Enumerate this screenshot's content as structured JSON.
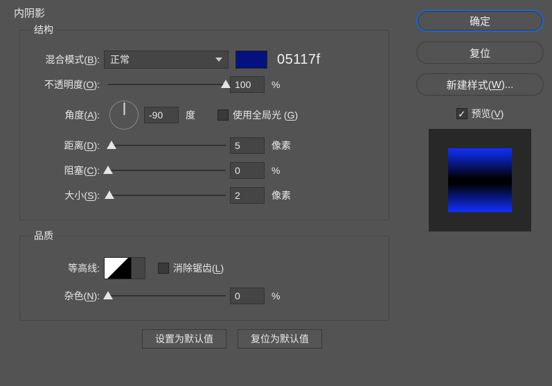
{
  "panel_title": "内阴影",
  "structure": {
    "legend": "结构",
    "blend_mode_label": "混合模式(B):",
    "blend_mode_value": "正常",
    "color_hex": "05117f",
    "opacity_label": "不透明度(O):",
    "opacity_value": "100",
    "opacity_unit": "%",
    "angle_label": "角度(A):",
    "angle_value": "-90",
    "angle_unit": "度",
    "use_global_light_label": "使用全局光 (G)",
    "use_global_light_checked": false,
    "distance_label": "距离(D):",
    "distance_value": "5",
    "distance_unit": "像素",
    "choke_label": "阻塞(C):",
    "choke_value": "0",
    "choke_unit": "%",
    "size_label": "大小(S):",
    "size_value": "2",
    "size_unit": "像素"
  },
  "quality": {
    "legend": "品质",
    "contour_label": "等高线:",
    "antialias_label": "消除锯齿(L)",
    "antialias_checked": false,
    "noise_label": "杂色(N):",
    "noise_value": "0",
    "noise_unit": "%"
  },
  "buttons": {
    "make_default": "设置为默认值",
    "reset_default": "复位为默认值"
  },
  "side": {
    "ok": "确定",
    "reset": "复位",
    "new_style": "新建样式(W)...",
    "preview_label": "预览(V)",
    "preview_checked": true
  }
}
